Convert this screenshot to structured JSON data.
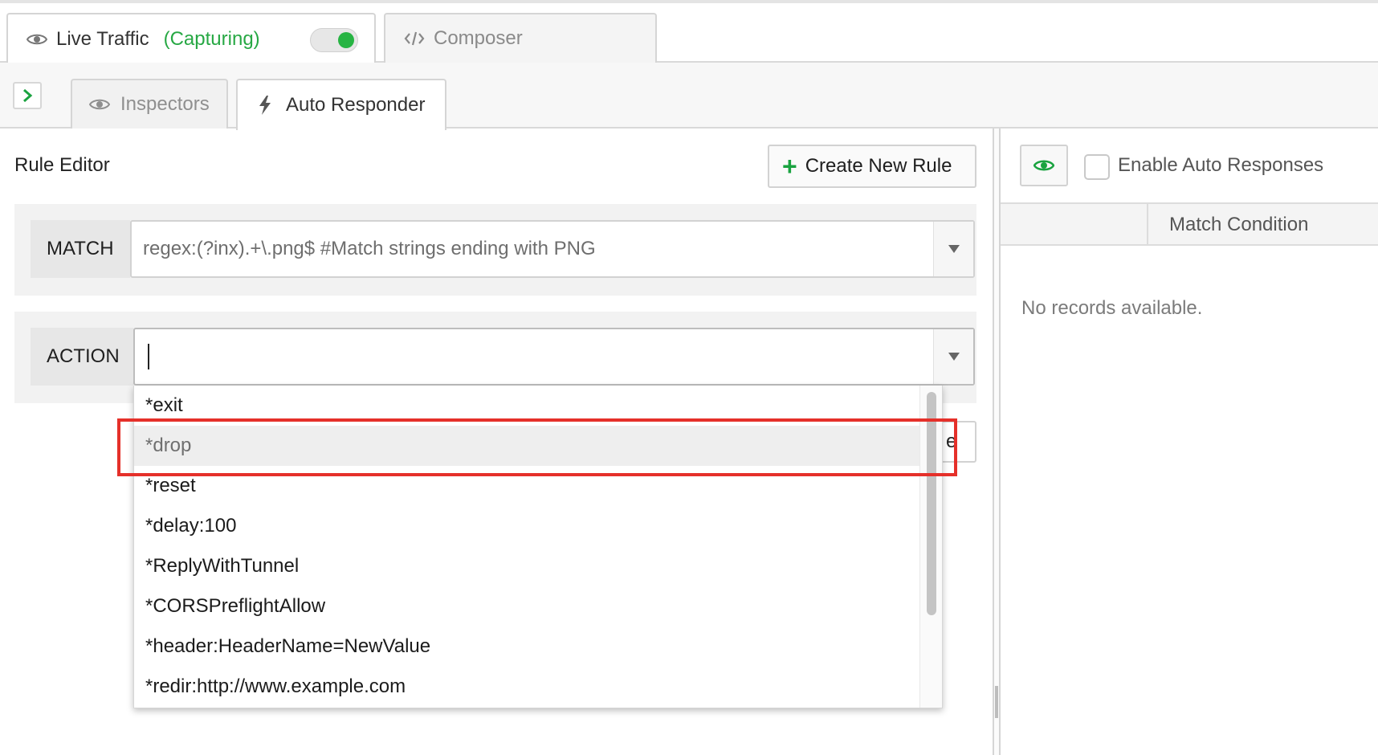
{
  "top_tabs": {
    "live_label": "Live Traffic",
    "capturing_label": "(Capturing)",
    "composer_label": "Composer"
  },
  "sub_tabs": {
    "inspectors_label": "Inspectors",
    "auto_responder_label": "Auto Responder"
  },
  "rule_editor": {
    "title": "Rule Editor",
    "create_button_label": "Create New Rule",
    "match_label": "MATCH",
    "match_value": "regex:(?inx).+\\.png$ #Match strings ending with PNG",
    "action_label": "ACTION",
    "action_value": "",
    "hidden_button_text": "e"
  },
  "action_dropdown": {
    "options": [
      "*exit",
      "*drop",
      "*reset",
      "*delay:100",
      "*ReplyWithTunnel",
      "*CORSPreflightAllow",
      "*header:HeaderName=NewValue",
      "*redir:http://www.example.com"
    ],
    "hovered_option": "*drop"
  },
  "right_panel": {
    "enable_label": "Enable Auto Responses",
    "enable_checked": false,
    "column_header": "Match Condition",
    "empty_text": "No records available."
  },
  "colors": {
    "accent_green": "#1aa340",
    "capturing_green": "#27a844",
    "highlight_red": "#e5302a"
  },
  "icons": {
    "live": "eye-icon",
    "composer": "code-icon",
    "inspectors": "eye-icon",
    "auto_responder": "lightning-icon",
    "expand": "chevron-right-icon",
    "dropdown": "caret-down-icon",
    "add": "plus-icon",
    "visibility": "eye-icon"
  },
  "toggle_capturing_on": true
}
